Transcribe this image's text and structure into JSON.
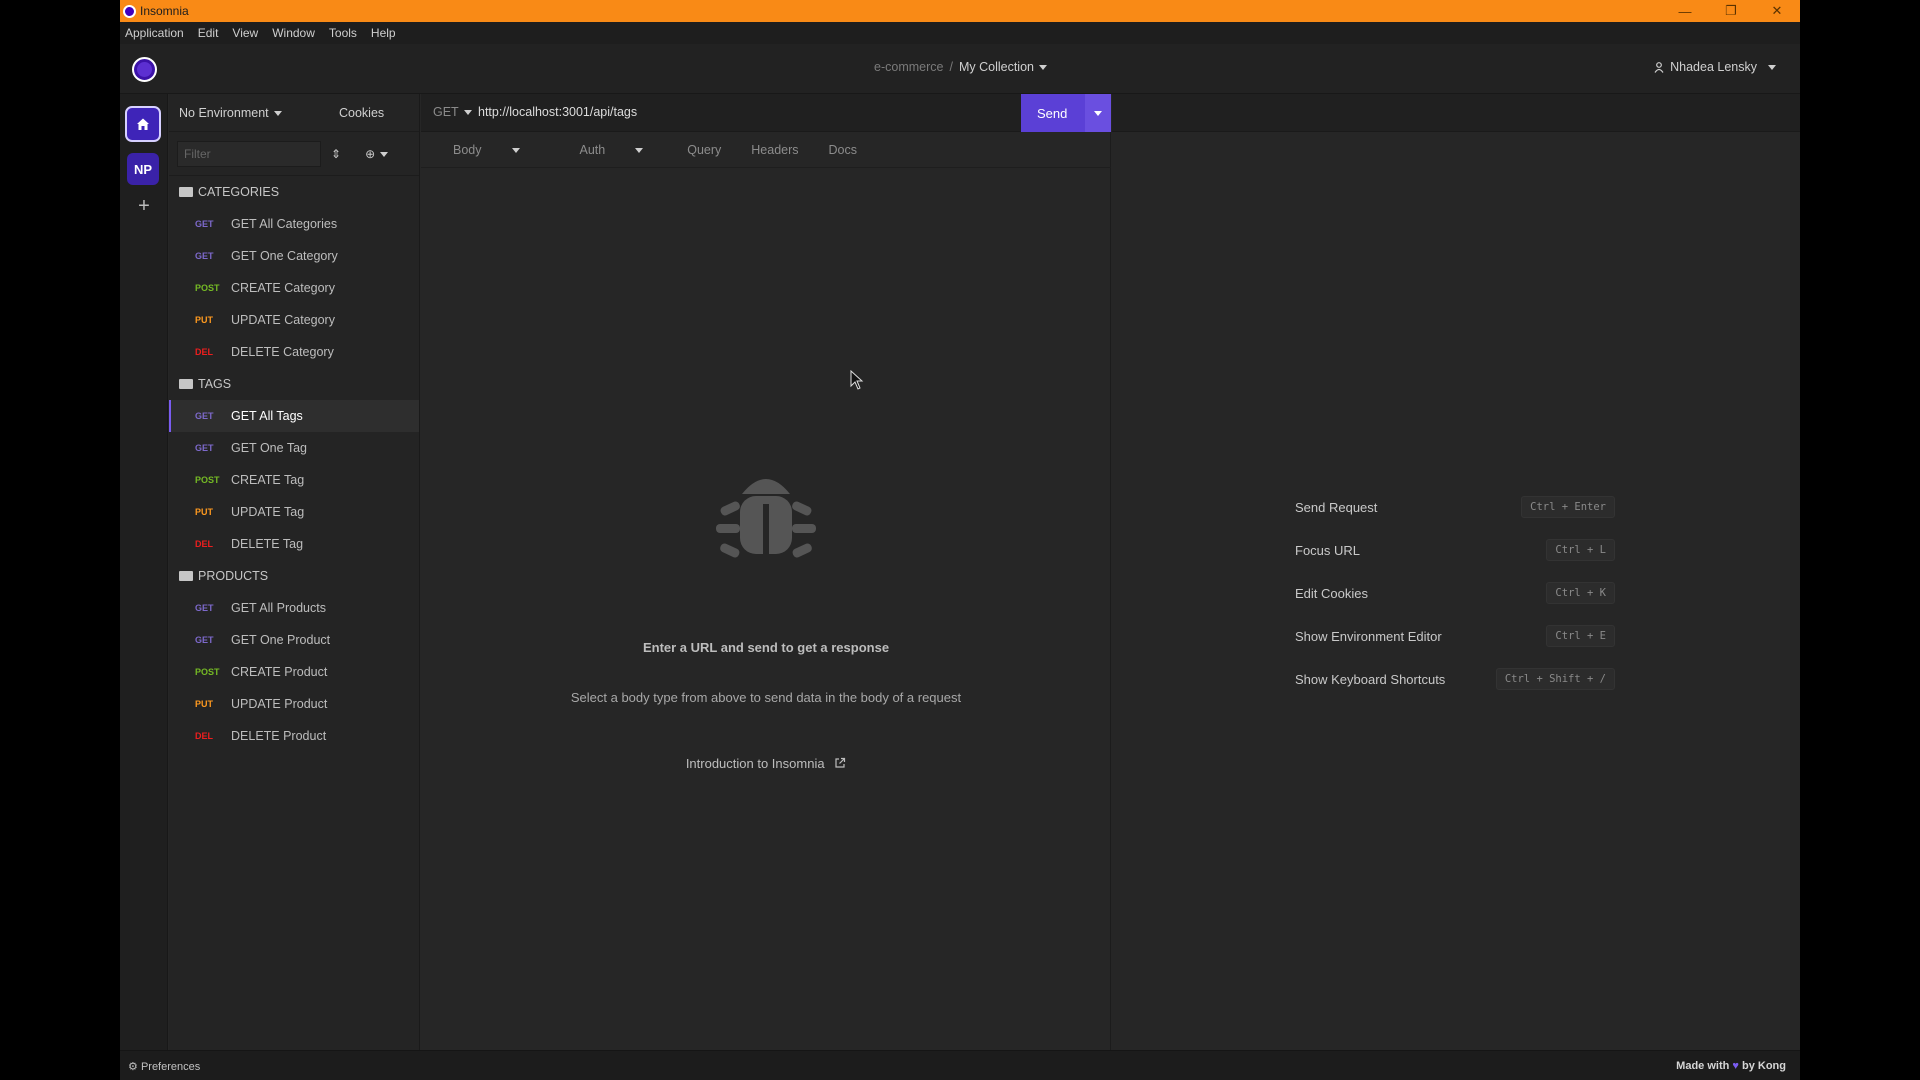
{
  "window": {
    "title": "Insomnia",
    "controls": [
      "minimize",
      "restore",
      "close"
    ]
  },
  "menu": [
    "Application",
    "Edit",
    "View",
    "Window",
    "Tools",
    "Help"
  ],
  "header": {
    "project": "e-commerce",
    "separator": "/",
    "collection": "My Collection",
    "user": "Nhadea Lensky"
  },
  "rail": {
    "workspace_initials": "NP",
    "add": "+"
  },
  "sidebar": {
    "environment": "No Environment",
    "cookies": "Cookies",
    "filter_placeholder": "Filter",
    "folders": [
      {
        "name": "CATEGORIES",
        "requests": [
          {
            "method": "GET",
            "name": "GET All Categories"
          },
          {
            "method": "GET",
            "name": "GET One Category"
          },
          {
            "method": "POST",
            "name": "CREATE Category"
          },
          {
            "method": "PUT",
            "name": "UPDATE Category"
          },
          {
            "method": "DEL",
            "name": "DELETE Category"
          }
        ]
      },
      {
        "name": "TAGS",
        "requests": [
          {
            "method": "GET",
            "name": "GET All Tags",
            "active": true
          },
          {
            "method": "GET",
            "name": "GET One Tag"
          },
          {
            "method": "POST",
            "name": "CREATE Tag"
          },
          {
            "method": "PUT",
            "name": "UPDATE Tag"
          },
          {
            "method": "DEL",
            "name": "DELETE Tag"
          }
        ]
      },
      {
        "name": "PRODUCTS",
        "requests": [
          {
            "method": "GET",
            "name": "GET All Products"
          },
          {
            "method": "GET",
            "name": "GET One Product"
          },
          {
            "method": "POST",
            "name": "CREATE Product"
          },
          {
            "method": "PUT",
            "name": "UPDATE Product"
          },
          {
            "method": "DEL",
            "name": "DELETE Product"
          }
        ]
      }
    ]
  },
  "method_colors": {
    "GET": "#7d69cb",
    "POST": "#75ba24",
    "PUT": "#ff9a1f",
    "DEL": "#ec1e1e"
  },
  "request": {
    "method": "GET",
    "url": "http://localhost:3001/api/tags",
    "send_label": "Send",
    "tabs": [
      "Body",
      "Auth",
      "Query",
      "Headers",
      "Docs"
    ],
    "empty_title": "Enter a URL and send to get a response",
    "empty_subtitle": "Select a body type from above to send data in the body of a request",
    "intro_link": "Introduction to Insomnia"
  },
  "shortcuts": [
    {
      "label": "Send Request",
      "keys": "Ctrl + Enter"
    },
    {
      "label": "Focus URL",
      "keys": "Ctrl + L"
    },
    {
      "label": "Edit Cookies",
      "keys": "Ctrl + K"
    },
    {
      "label": "Show Environment Editor",
      "keys": "Ctrl + E"
    },
    {
      "label": "Show Keyboard Shortcuts",
      "keys": "Ctrl + Shift + /"
    }
  ],
  "footer": {
    "preferences": "Preferences",
    "made_with": "Made with",
    "by": "by Kong"
  }
}
